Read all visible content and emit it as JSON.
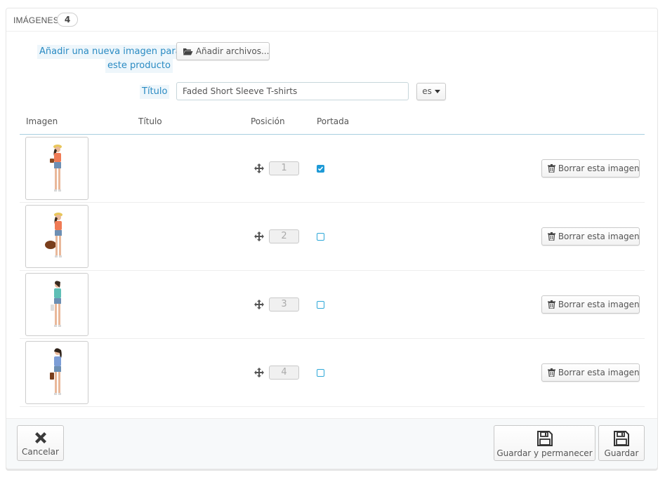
{
  "panel": {
    "title": "IMÁGENES",
    "count": "4"
  },
  "form": {
    "add_label": [
      "Añadir una nueva imagen para",
      "este producto"
    ],
    "add_button": "Añadir archivos...",
    "title_label": "Título",
    "title_value": "Faded Short Sleeve T-shirts",
    "lang_button": "es"
  },
  "table": {
    "headers": [
      "Imagen",
      "Título",
      "Posición",
      "Portada"
    ],
    "rows": [
      {
        "position": "1",
        "cover": true,
        "delete_label": "Borrar esta imagen"
      },
      {
        "position": "2",
        "cover": false,
        "delete_label": "Borrar esta imagen"
      },
      {
        "position": "3",
        "cover": false,
        "delete_label": "Borrar esta imagen"
      },
      {
        "position": "4",
        "cover": false,
        "delete_label": "Borrar esta imagen"
      }
    ]
  },
  "footer": {
    "cancel": "Cancelar",
    "save_stay": "Guardar y permanecer",
    "save": "Guardar"
  },
  "colors": {
    "accent": "#2a8bc3",
    "checkbox": "#1e9ad6"
  }
}
